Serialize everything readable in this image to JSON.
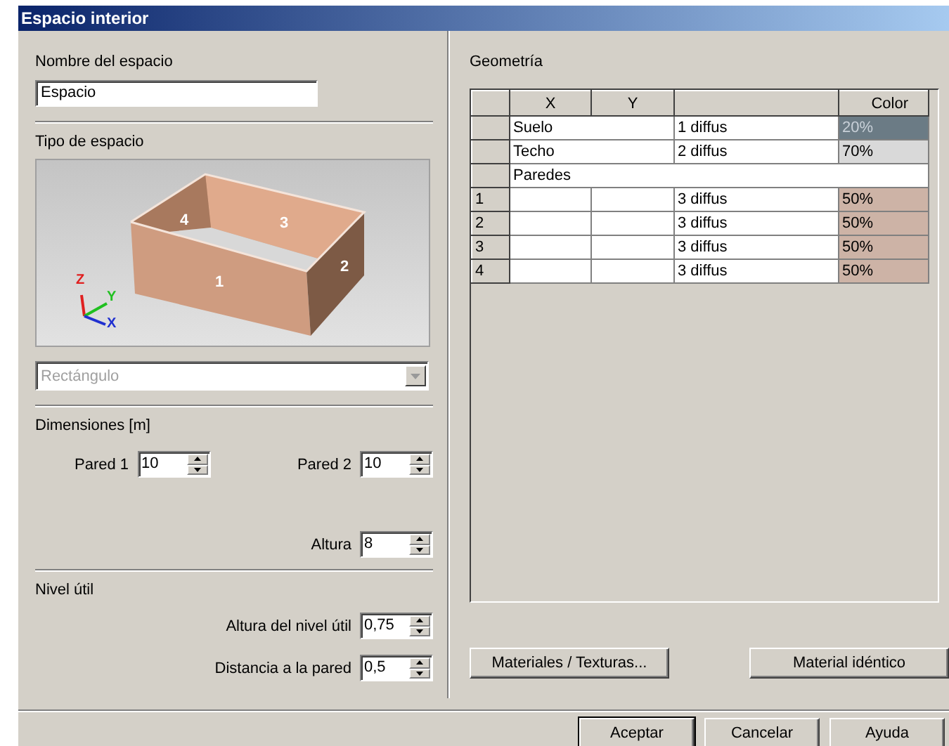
{
  "window": {
    "title": "Espacio interior"
  },
  "name_field": {
    "label": "Nombre del espacio",
    "value": "Espacio"
  },
  "space_type": {
    "label": "Tipo de espacio",
    "wall_labels": [
      "4",
      "3",
      "1",
      "2"
    ],
    "axes": [
      "Z",
      "Y",
      "X"
    ],
    "dropdown": {
      "value": "Rectángulo",
      "disabled": true
    }
  },
  "dimensions": {
    "label": "Dimensiones [m]",
    "fields": [
      {
        "label": "Pared 1",
        "value": "10"
      },
      {
        "label": "Pared 2",
        "value": "10"
      },
      {
        "label": "Altura",
        "value": "8"
      }
    ]
  },
  "useful_level": {
    "label": "Nivel útil",
    "fields": [
      {
        "label": "Altura del nivel útil",
        "value": "0,75"
      },
      {
        "label": "Distancia a la pared",
        "value": "0,5"
      }
    ]
  },
  "geometry": {
    "label": "Geometría",
    "columns": [
      "X",
      "Y",
      "Color"
    ],
    "rows": [
      {
        "kind": "surface",
        "name": "Suelo",
        "material": "1 diffus",
        "color_value": "20%",
        "color": "#6b7b85"
      },
      {
        "kind": "surface",
        "name": "Techo",
        "material": "2 diffus",
        "color_value": "70%",
        "color": "#d9d9d9"
      },
      {
        "kind": "group",
        "name": "Paredes"
      },
      {
        "kind": "wall",
        "index": "1",
        "material": "3 diffus",
        "color_value": "50%",
        "color": "#cdb3a6"
      },
      {
        "kind": "wall",
        "index": "2",
        "material": "3 diffus",
        "color_value": "50%",
        "color": "#cdb3a6"
      },
      {
        "kind": "wall",
        "index": "3",
        "material": "3 diffus",
        "color_value": "50%",
        "color": "#cdb3a6"
      },
      {
        "kind": "wall",
        "index": "4",
        "material": "3 diffus",
        "color_value": "50%",
        "color": "#cdb3a6"
      }
    ],
    "buttons": [
      "Materiales / Texturas...",
      "Material idéntico"
    ]
  },
  "dialog_buttons": [
    "Aceptar",
    "Cancelar",
    "Ayuda"
  ]
}
